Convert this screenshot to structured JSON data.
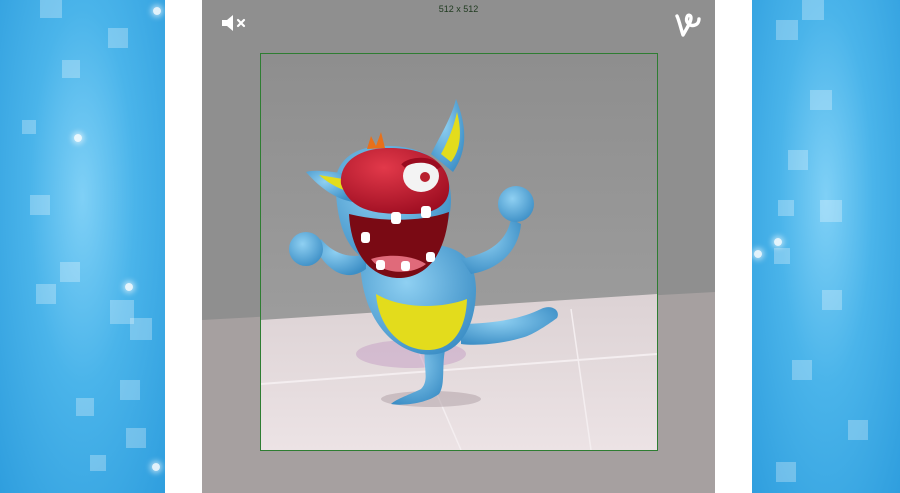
{
  "player": {
    "dimension_label": "512 x 512",
    "mute_button": "mute-icon",
    "brand_icon": "vine-logo-icon"
  },
  "colors": {
    "background_blue": "#4ab4ea",
    "player_gray": "#8f8f8f",
    "frame_border": "#2e7d32",
    "monster_blue": "#5aa8d8",
    "monster_red": "#c8102e",
    "belly_yellow": "#e8e020"
  }
}
